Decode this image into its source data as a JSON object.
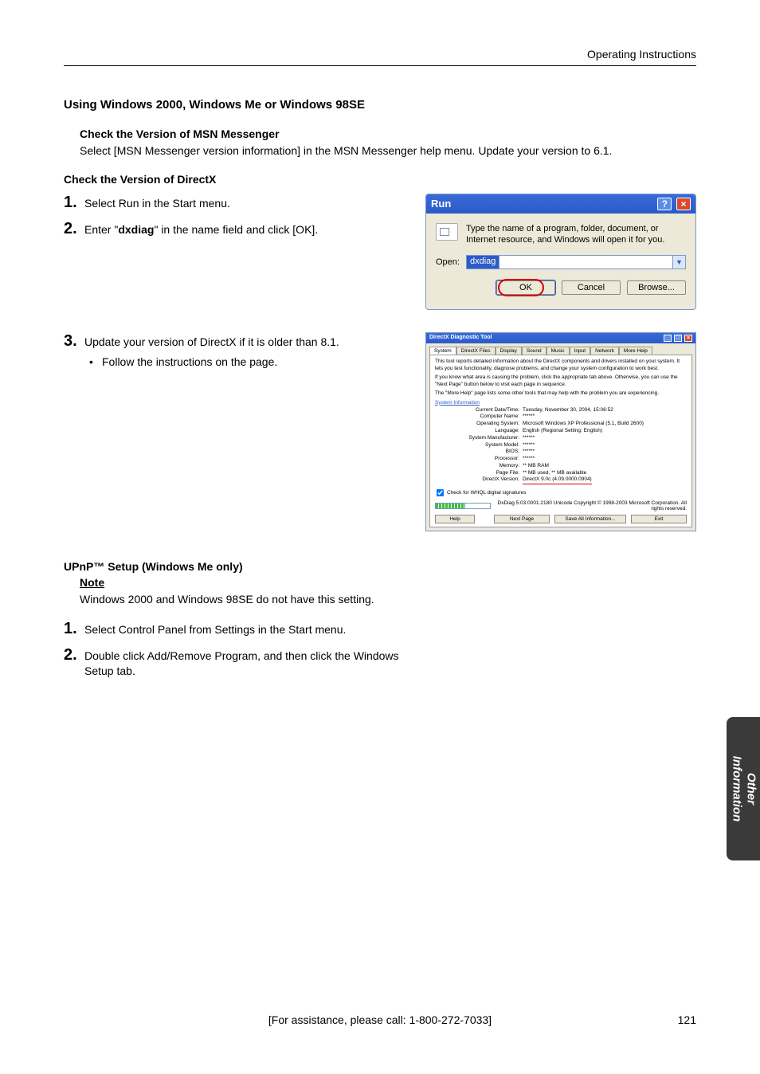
{
  "header": {
    "section_label": "Operating Instructions"
  },
  "h1": "Using Windows 2000, Windows Me or Windows 98SE",
  "msn": {
    "head": "Check the Version of MSN Messenger",
    "body": "Select [MSN Messenger version information] in the MSN Messenger help menu. Update your version to 6.1."
  },
  "dx_head": "Check the Version of DirectX",
  "dx_steps": {
    "s1": "Select Run in the Start menu.",
    "s2_pre": "Enter \"",
    "s2_cmd": "dxdiag",
    "s2_post": "\" in the name field and click [OK].",
    "s3": "Update your version of DirectX if it is older than 8.1.",
    "s3_bullet": "Follow the instructions on the page."
  },
  "run_dialog": {
    "title": "Run",
    "desc": "Type the name of a program, folder, document, or Internet resource, and Windows will open it for you.",
    "open_label": "Open:",
    "open_value": "dxdiag",
    "ok": "OK",
    "cancel": "Cancel",
    "browse": "Browse..."
  },
  "dxdiag_dialog": {
    "title": "DirectX Diagnostic Tool",
    "tabs": [
      "System",
      "DirectX Files",
      "Display",
      "Sound",
      "Music",
      "Input",
      "Network",
      "More Help"
    ],
    "intro1": "This tool reports detailed information about the DirectX components and drivers installed on your system. It lets you test functionality, diagnose problems, and change your system configuration to work best.",
    "intro2": "If you know what area is causing the problem, click the appropriate tab above. Otherwise, you can use the \"Next Page\" button below to visit each page in sequence.",
    "intro3": "The \"More Help\" page lists some other tools that may help with the problem you are experiencing.",
    "sys_head": "System Information",
    "kv": [
      {
        "k": "Current Date/Time:",
        "v": "Tuesday, November 30, 2004, 15:06:52"
      },
      {
        "k": "Computer Name:",
        "v": "******"
      },
      {
        "k": "Operating System:",
        "v": "Microsoft Windows XP Professional (5.1, Build 2600)"
      },
      {
        "k": "Language:",
        "v": "English (Regional Setting: English)"
      },
      {
        "k": "System Manufacturer:",
        "v": "******"
      },
      {
        "k": "System Model:",
        "v": "******"
      },
      {
        "k": "BIOS:",
        "v": "******"
      },
      {
        "k": "Processor:",
        "v": "******"
      },
      {
        "k": "Memory:",
        "v": "** MB RAM"
      },
      {
        "k": "Page File:",
        "v": "** MB used, ** MB available"
      },
      {
        "k": "DirectX Version:",
        "v": "DirectX 9.0c (4.09.0000.0904)"
      }
    ],
    "whql": "Check for WHQL digital signatures",
    "copyright": "DxDiag 5.03.0001.2180 Unicode  Copyright © 1998-2003 Microsoft Corporation. All rights reserved.",
    "help": "Help",
    "next": "Next Page",
    "save": "Save All Information...",
    "exit": "Exit"
  },
  "upnp": {
    "head": "UPnP™ Setup (Windows Me only)",
    "note_label": "Note",
    "note_body": "Windows 2000 and Windows 98SE do not have this setting.",
    "s1": "Select Control Panel from Settings in the Start menu.",
    "s2": "Double click Add/Remove Program, and then click the Windows Setup tab."
  },
  "side_tab": {
    "line1": "Other",
    "line2": "Information"
  },
  "footer": {
    "assist": "[For assistance, please call: 1-800-272-7033]",
    "page": "121"
  }
}
